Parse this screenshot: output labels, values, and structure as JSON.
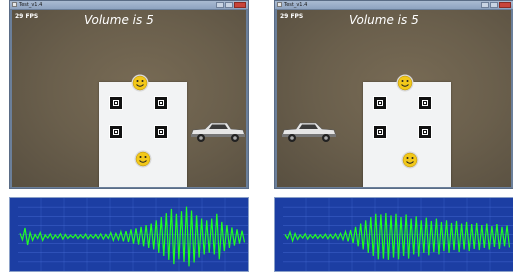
{
  "windows": [
    {
      "title": "Test_v1.4",
      "fps": "29 FPS",
      "volume": "Volume is 5"
    },
    {
      "title": "Test_v1.4",
      "fps": "29 FPS",
      "volume": "Volume is 5"
    }
  ],
  "colors": {
    "window_frame": "#6b7f9a",
    "plot_bg": "#1c3ea3",
    "wave": "#22ff22",
    "grid": "#4a6fd8"
  },
  "icons": [
    "smiley-face-icon",
    "pickup-truck-icon",
    "fiducial-marker-icon"
  ],
  "waveform": {
    "left": {
      "amplitudes": [
        0.1,
        0.26,
        0.12,
        0.06,
        0.12,
        0.05,
        0.08,
        0.05,
        0.08,
        0.06,
        0.04,
        0.06,
        0.05,
        0.07,
        0.05,
        0.06,
        0.08,
        0.06,
        0.12,
        0.1,
        0.15,
        0.17,
        0.22,
        0.25,
        0.3,
        0.35,
        0.4,
        0.5,
        0.6,
        0.72,
        0.85,
        0.7,
        0.78,
        0.92,
        0.8,
        0.65,
        0.55,
        0.5,
        0.55,
        0.7,
        0.45,
        0.35,
        0.28,
        0.22,
        0.18
      ]
    },
    "right": {
      "amplitudes": [
        0.06,
        0.14,
        0.09,
        0.05,
        0.08,
        0.05,
        0.06,
        0.05,
        0.07,
        0.06,
        0.08,
        0.1,
        0.15,
        0.2,
        0.3,
        0.4,
        0.5,
        0.6,
        0.7,
        0.68,
        0.72,
        0.65,
        0.7,
        0.6,
        0.68,
        0.55,
        0.62,
        0.5,
        0.58,
        0.48,
        0.55,
        0.45,
        0.5,
        0.42,
        0.48,
        0.4,
        0.45,
        0.38,
        0.42,
        0.35,
        0.4,
        0.32,
        0.38,
        0.3,
        0.34
      ]
    }
  }
}
